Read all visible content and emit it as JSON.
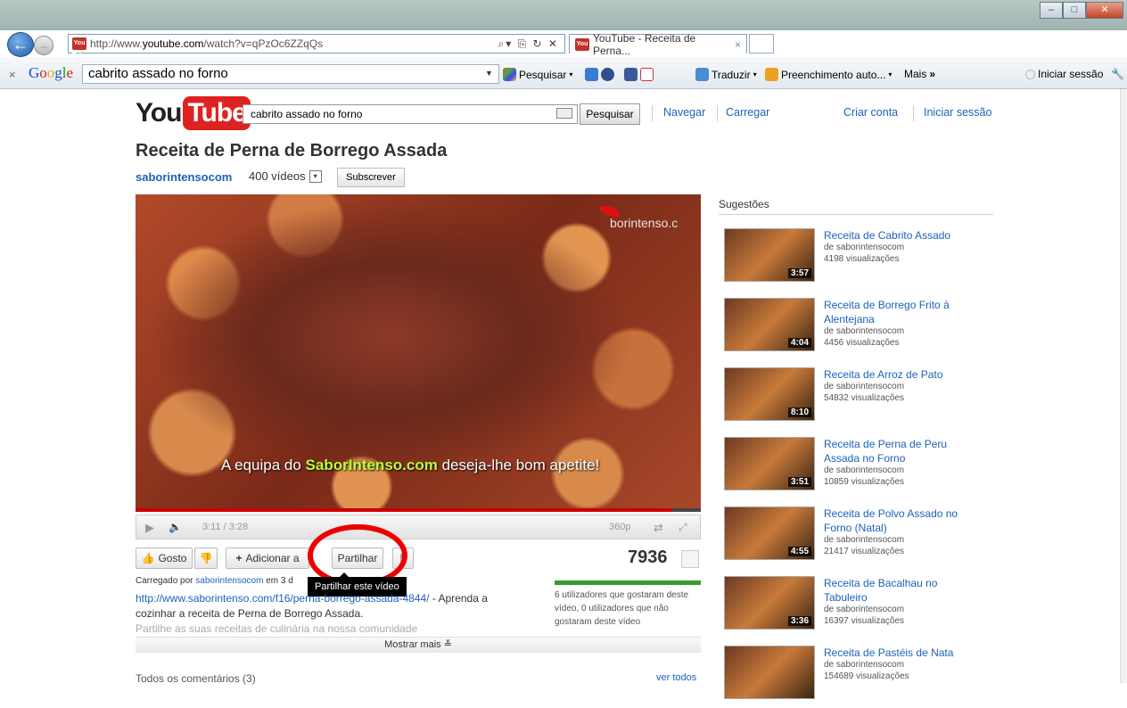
{
  "browser": {
    "url_prefix": "http://www.",
    "url_domain": "youtube.com",
    "url_rest": "/watch?v=qPzOc6ZZqQs",
    "tab_title": "YouTube - Receita de Perna...",
    "favicon_text": "You Tube"
  },
  "google_toolbar": {
    "search_value": "cabrito assado no forno",
    "pesquisar": "Pesquisar",
    "traduzir": "Traduzir",
    "preenchimento": "Preenchimento auto...",
    "mais": "Mais",
    "iniciar": "Iniciar sessão"
  },
  "yt": {
    "logo_you": "You",
    "logo_tube": "Tube",
    "search_value": "cabrito assado no forno",
    "search_button": "Pesquisar",
    "navegar": "Navegar",
    "carregar": "Carregar",
    "criar_conta": "Criar conta",
    "iniciar_sessao": "Iniciar sessão"
  },
  "video": {
    "title": "Receita de Perna de Borrego Assada",
    "channel": "saborintensocom",
    "video_count": "400 vídeos",
    "subscribe": "Subscrever",
    "watermark": "borintenso.c",
    "caption_pre": "A equipa do ",
    "caption_brand": "SaborIntenso.com",
    "caption_post": " deseja-lhe bom apetite!",
    "time": "3:11 / 3:28",
    "quality": "360p",
    "progress": 0.95,
    "views": "7936"
  },
  "actions": {
    "gosto": "Gosto",
    "adicionar": "Adicionar a",
    "partilhar": "Partilhar",
    "tooltip": "Partilhar este vídeo"
  },
  "description": {
    "carregado_por": "Carregado por",
    "uploader": "saborintensocom",
    "em": " em 3 d",
    "link": "http://www.saborintenso.com/f16/perna-borrego-assada-4844/",
    "text1": " - Aprenda a cozinhar a receita de Perna de Borrego Assada.",
    "text2": "Partilhe as suas receitas de culinária na nossa comunidade",
    "likes_text": "6 utilizadores que gostaram deste vídeo, 0 utilizadores que não gostaram deste vídeo",
    "show_more": "Mostrar mais",
    "comments": "Todos os comentários (3)",
    "ver_todos": "ver todos"
  },
  "suggestions": {
    "title": "Sugestões",
    "items": [
      {
        "title": "Receita de Cabrito Assado",
        "by": "de saborintensocom",
        "views": "4198 visualizações",
        "duration": "3:57"
      },
      {
        "title": "Receita de Borrego Frito à Alentejana",
        "by": "de saborintensocom",
        "views": "4456 visualizações",
        "duration": "4:04"
      },
      {
        "title": "Receita de Arroz de Pato",
        "by": "de saborintensocom",
        "views": "54832 visualizações",
        "duration": "8:10"
      },
      {
        "title": "Receita de Perna de Peru Assada no Forno",
        "by": "de saborintensocom",
        "views": "10859 visualizações",
        "duration": "3:51"
      },
      {
        "title": "Receita de Polvo Assado no Forno (Natal)",
        "by": "de saborintensocom",
        "views": "21417 visualizações",
        "duration": "4:55"
      },
      {
        "title": "Receita de Bacalhau no Tabuleiro",
        "by": "de saborintensocom",
        "views": "16397 visualizações",
        "duration": "3:36"
      },
      {
        "title": "Receita de Pastéis de Nata",
        "by": "de saborintensocom",
        "views": "154689 visualizações",
        "duration": ""
      }
    ]
  }
}
